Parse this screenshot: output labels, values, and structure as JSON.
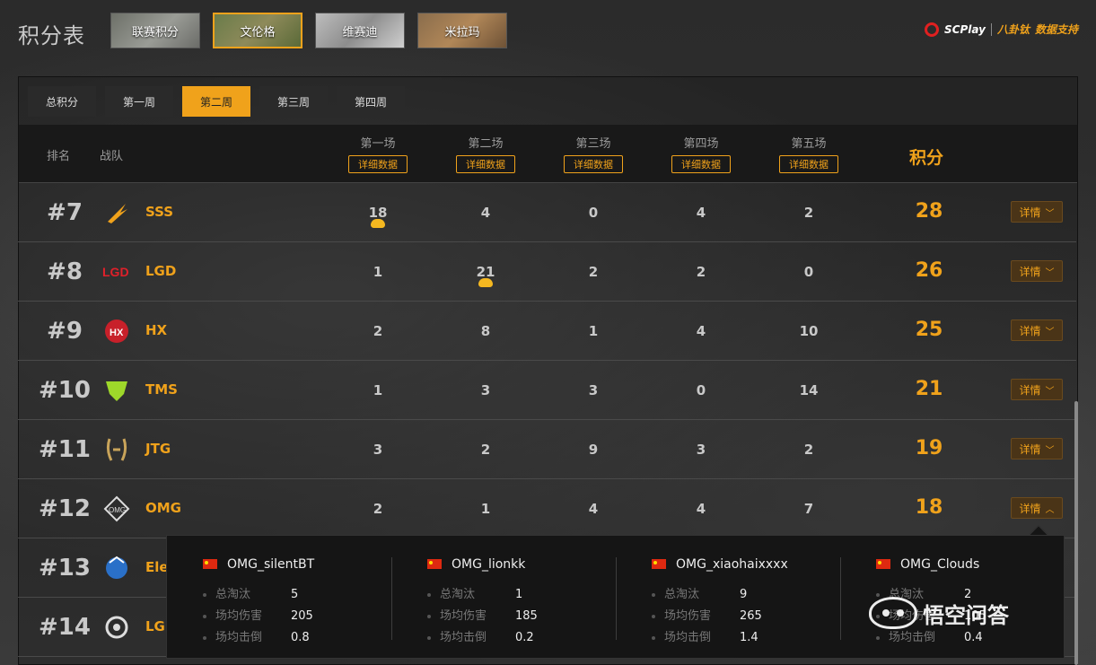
{
  "page_title": "积分表",
  "map_tabs": [
    {
      "label": "联赛积分",
      "active": false
    },
    {
      "label": "文伦格",
      "active": true
    },
    {
      "label": "维赛迪",
      "active": false
    },
    {
      "label": "米拉玛",
      "active": false
    }
  ],
  "sponsor": {
    "brand_a": "SCPlay",
    "brand_b": "八卦钛",
    "text": "数据支持"
  },
  "week_tabs": [
    {
      "label": "总积分",
      "active": false
    },
    {
      "label": "第一周",
      "active": false
    },
    {
      "label": "第二周",
      "active": true
    },
    {
      "label": "第三周",
      "active": false
    },
    {
      "label": "第四周",
      "active": false
    }
  ],
  "table": {
    "col_rank": "排名",
    "col_team": "战队",
    "games": [
      "第一场",
      "第二场",
      "第三场",
      "第四场",
      "第五场"
    ],
    "detail_data_label": "详细数据",
    "col_points": "积分",
    "detail_label": "详情",
    "rows": [
      {
        "rank": "#7",
        "team": "SSS",
        "games": [
          "18",
          "4",
          "0",
          "4",
          "2"
        ],
        "total": "28",
        "chicken_game": 0,
        "expanded": false
      },
      {
        "rank": "#8",
        "team": "LGD",
        "games": [
          "1",
          "21",
          "2",
          "2",
          "0"
        ],
        "total": "26",
        "chicken_game": 1,
        "expanded": false
      },
      {
        "rank": "#9",
        "team": "HX",
        "games": [
          "2",
          "8",
          "1",
          "4",
          "10"
        ],
        "total": "25",
        "chicken_game": -1,
        "expanded": false
      },
      {
        "rank": "#10",
        "team": "TMS",
        "games": [
          "1",
          "3",
          "3",
          "0",
          "14"
        ],
        "total": "21",
        "chicken_game": -1,
        "expanded": false
      },
      {
        "rank": "#11",
        "team": "JTG",
        "games": [
          "3",
          "2",
          "9",
          "3",
          "2"
        ],
        "total": "19",
        "chicken_game": -1,
        "expanded": false
      },
      {
        "rank": "#12",
        "team": "OMG",
        "games": [
          "2",
          "1",
          "4",
          "4",
          "7"
        ],
        "total": "18",
        "chicken_game": -1,
        "expanded": true
      },
      {
        "rank": "#13",
        "team": "Ele",
        "games": [],
        "total": "",
        "chicken_game": -1,
        "expanded": false
      },
      {
        "rank": "#14",
        "team": "LGI",
        "games": [],
        "total": "",
        "chicken_game": -1,
        "expanded": false
      }
    ]
  },
  "player_panel": {
    "stat_labels": [
      "总淘汰",
      "场均伤害",
      "场均击倒"
    ],
    "players": [
      {
        "name": "OMG_silentBT",
        "stats": [
          "5",
          "205",
          "0.8"
        ]
      },
      {
        "name": "OMG_lionkk",
        "stats": [
          "1",
          "185",
          "0.2"
        ]
      },
      {
        "name": "OMG_xiaohaixxxx",
        "stats": [
          "9",
          "265",
          "1.4"
        ]
      },
      {
        "name": "OMG_Clouds",
        "stats": [
          "2",
          "105",
          "0.4"
        ]
      }
    ]
  },
  "watermark": "悟空问答",
  "colors": {
    "accent": "#f0a21b",
    "flag_red": "#de2910"
  }
}
